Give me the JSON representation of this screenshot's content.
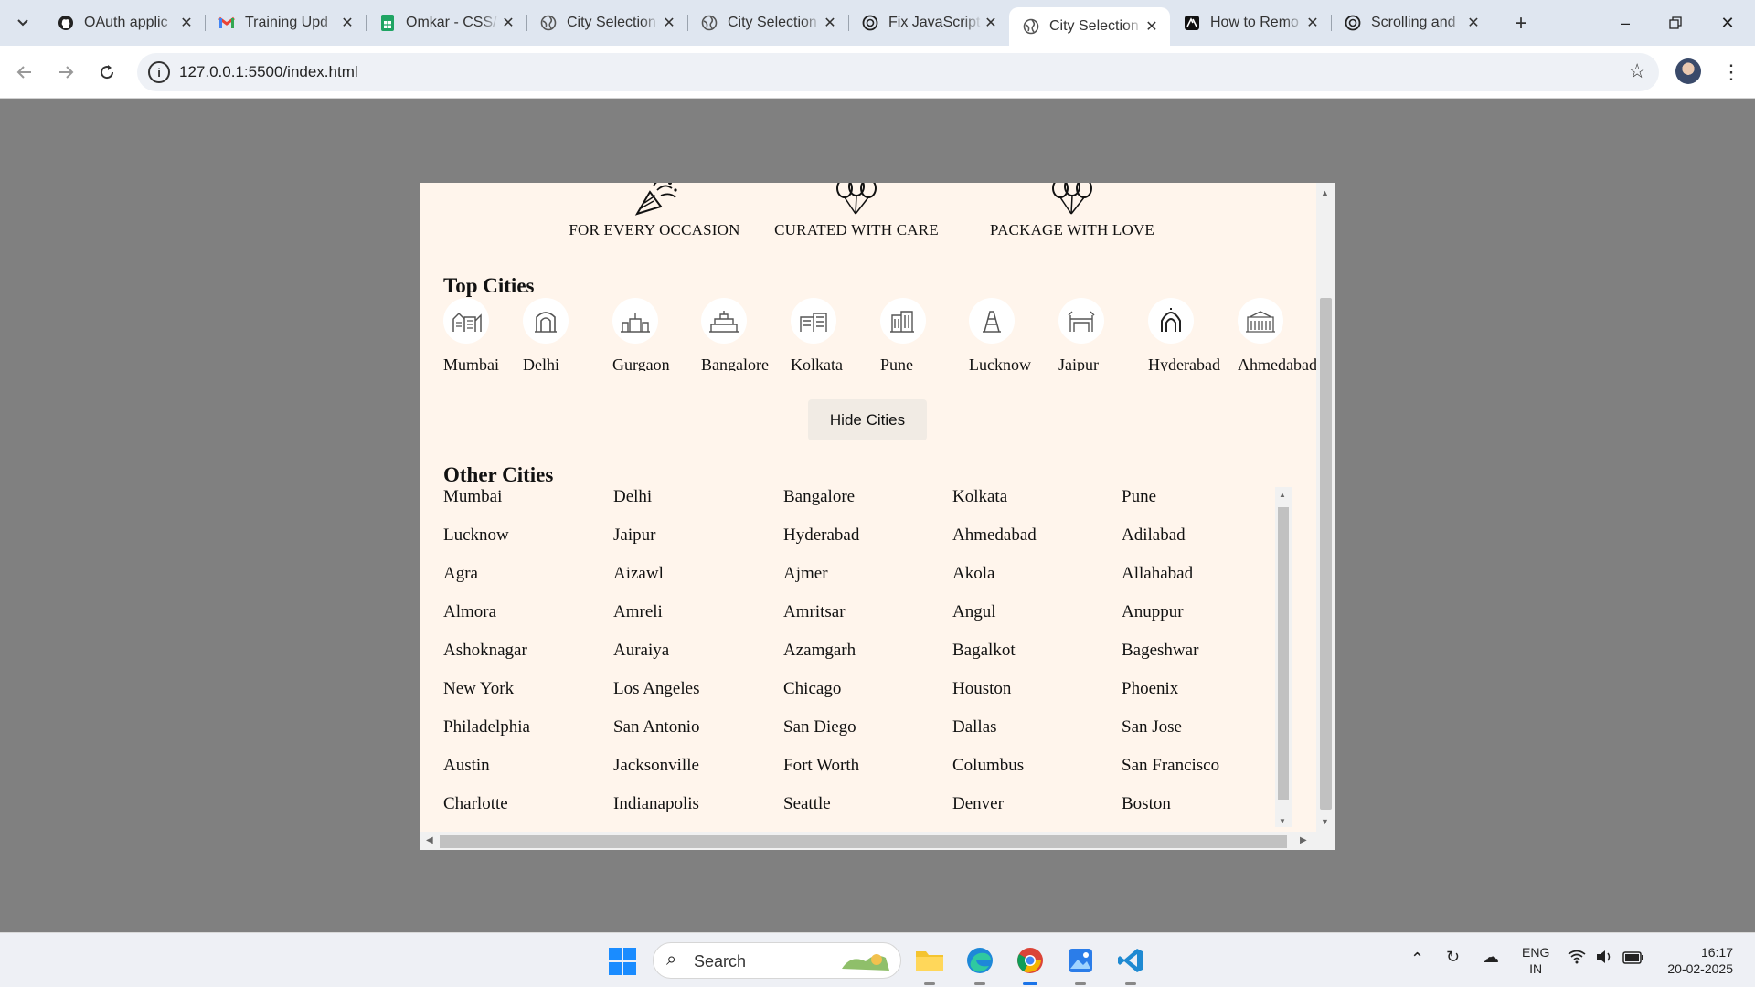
{
  "browser": {
    "tabs": [
      {
        "title": "OAuth applic",
        "icon": "github-icon"
      },
      {
        "title": "Training Upd",
        "icon": "gmail-icon"
      },
      {
        "title": "Omkar - CSS/",
        "icon": "sheets-icon"
      },
      {
        "title": "City Selection",
        "icon": "globe-icon"
      },
      {
        "title": "City Selection",
        "icon": "globe-icon"
      },
      {
        "title": "Fix JavaScript",
        "icon": "chatgpt-icon"
      },
      {
        "title": "City Selection",
        "icon": "globe-icon",
        "active": true
      },
      {
        "title": "How to Remo",
        "icon": "ai-icon"
      },
      {
        "title": "Scrolling and",
        "icon": "chatgpt-icon"
      }
    ],
    "url": "127.0.0.1:5500/index.html"
  },
  "page": {
    "features": [
      {
        "label": "FOR EVERY OCCASION",
        "icon": "party-popper-icon"
      },
      {
        "label": "CURATED WITH CARE",
        "icon": "balloons-icon"
      },
      {
        "label": "PACKAGE WITH LOVE",
        "icon": "balloons-icon"
      }
    ],
    "top_cities_title": "Top Cities",
    "top_cities": [
      "Mumbai",
      "Delhi",
      "Gurgaon",
      "Bangalore",
      "Kolkata",
      "Pune",
      "Lucknow",
      "Jaipur",
      "Hyderabad",
      "Ahmedabad"
    ],
    "hide_button": "Hide Cities",
    "other_cities_title": "Other Cities",
    "other_cities": [
      "Mumbai",
      "Delhi",
      "Bangalore",
      "Kolkata",
      "Pune",
      "Lucknow",
      "Jaipur",
      "Hyderabad",
      "Ahmedabad",
      "Adilabad",
      "Agra",
      "Aizawl",
      "Ajmer",
      "Akola",
      "Allahabad",
      "Almora",
      "Amreli",
      "Amritsar",
      "Angul",
      "Anuppur",
      "Ashoknagar",
      "Auraiya",
      "Azamgarh",
      "Bagalkot",
      "Bageshwar",
      "New York",
      "Los Angeles",
      "Chicago",
      "Houston",
      "Phoenix",
      "Philadelphia",
      "San Antonio",
      "San Diego",
      "Dallas",
      "San Jose",
      "Austin",
      "Jacksonville",
      "Fort Worth",
      "Columbus",
      "San Francisco",
      "Charlotte",
      "Indianapolis",
      "Seattle",
      "Denver",
      "Boston"
    ]
  },
  "taskbar": {
    "search_placeholder": "Search",
    "lang_line1": "ENG",
    "lang_line2": "IN",
    "time": "16:17",
    "date": "20-02-2025",
    "accent": "#1a73e8"
  }
}
